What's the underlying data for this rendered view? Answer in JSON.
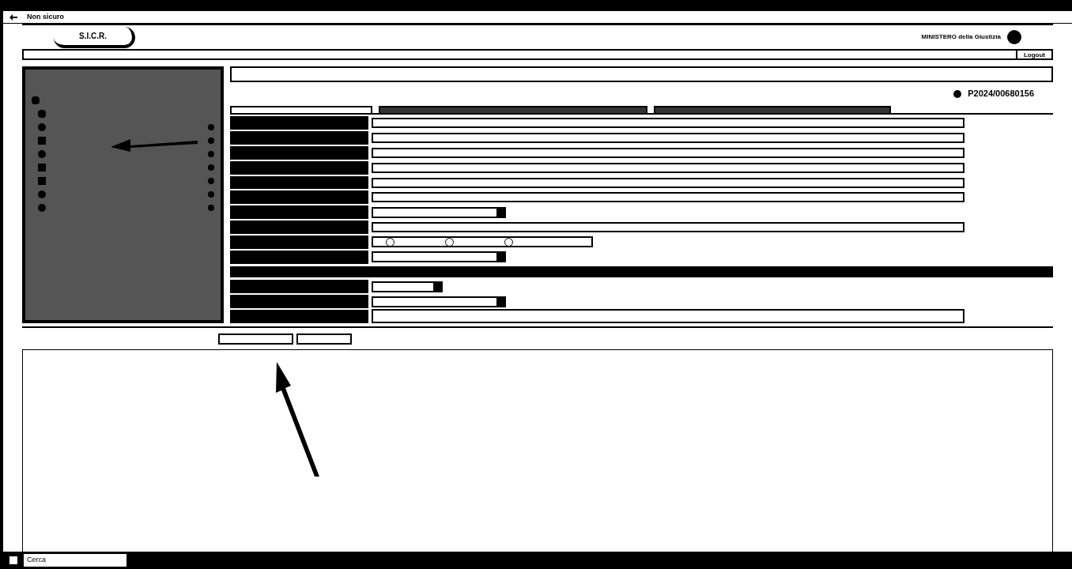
{
  "browser": {
    "address_prefix": "Non sicuro"
  },
  "header": {
    "logo": "S.I.C.R.",
    "ministry": "MINISTERO della Giustizia",
    "logout": "Logout"
  },
  "sidebar": {
    "items": [
      {
        "kind": "folder",
        "dot": false
      },
      {
        "kind": "doc",
        "dot": false
      },
      {
        "kind": "circle",
        "dot": true
      },
      {
        "kind": "square",
        "dot": true
      },
      {
        "kind": "circle",
        "dot": true
      },
      {
        "kind": "square",
        "dot": true
      },
      {
        "kind": "square",
        "dot": true
      },
      {
        "kind": "circle",
        "dot": true
      },
      {
        "kind": "circle",
        "dot": true
      }
    ]
  },
  "record": {
    "number": "P2024/00680156"
  },
  "form": {
    "tabs": [
      {
        "selected": true
      },
      {
        "selected": false
      },
      {
        "selected": false
      }
    ],
    "rows": [
      {
        "kind": "text"
      },
      {
        "kind": "text"
      },
      {
        "kind": "text"
      },
      {
        "kind": "text"
      },
      {
        "kind": "text"
      },
      {
        "kind": "text"
      },
      {
        "kind": "select"
      },
      {
        "kind": "text"
      },
      {
        "kind": "radio",
        "options": [
          {
            "selected": false
          },
          {
            "selected": false
          },
          {
            "selected": false
          }
        ]
      },
      {
        "kind": "select"
      },
      {
        "kind": "section"
      },
      {
        "kind": "date"
      },
      {
        "kind": "select"
      },
      {
        "kind": "area"
      }
    ]
  },
  "taskbar": {
    "search": "Cerca"
  }
}
